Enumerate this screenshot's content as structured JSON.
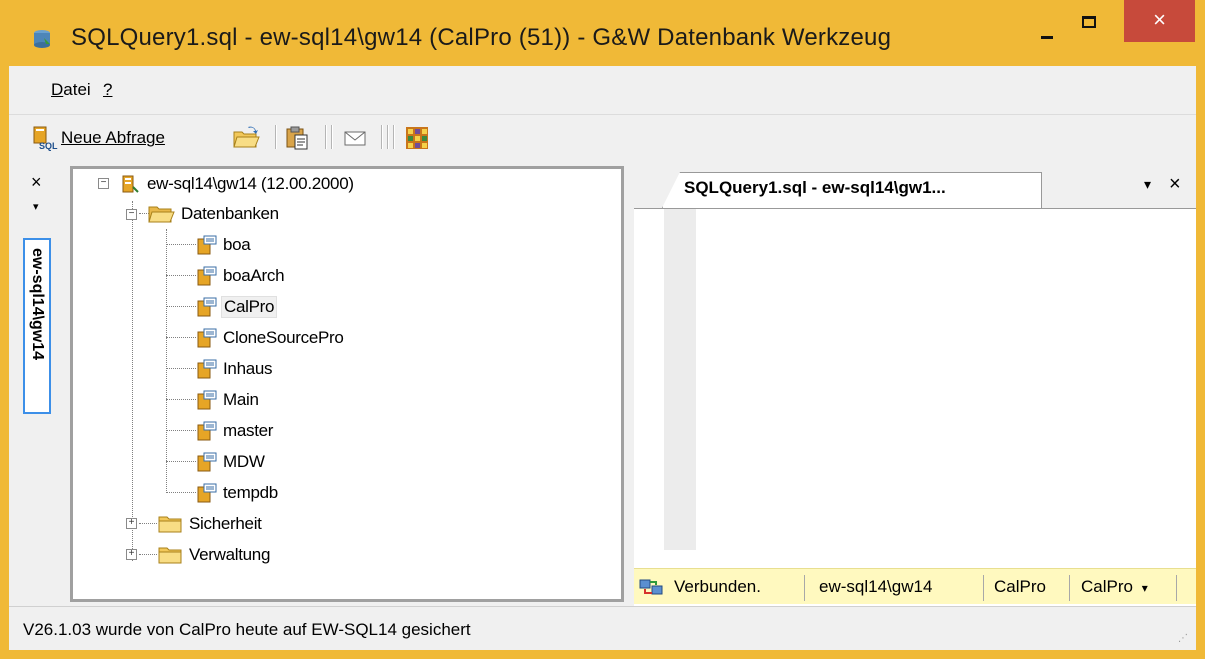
{
  "window": {
    "title": "SQLQuery1.sql - ew-sql14\\gw14 (CalPro (51)) - G&W Datenbank Werkzeug",
    "accent_color": "#f0b937",
    "close_color": "#c74a3b",
    "controls": {
      "minimize": "minimize-icon",
      "maximize": "maximize-icon",
      "close": "×"
    }
  },
  "menu": {
    "items": [
      {
        "label": "Datei",
        "accel": "D"
      },
      {
        "label": "?",
        "accel": "?"
      }
    ]
  },
  "toolbar": {
    "new_query_label": "Neue Abfrage",
    "new_query_accel": "N",
    "icons": [
      "new-query-icon",
      "open-folder-icon",
      "paste-icon",
      "mail-icon",
      "grid-icon"
    ]
  },
  "side_panel": {
    "close": "×",
    "pin": "▾",
    "tab_label": "ew-sql14\\gw14"
  },
  "tree": {
    "server": {
      "label": "ew-sql14\\gw14 (12.00.2000)",
      "expanded": true
    },
    "folders": [
      {
        "label": "Datenbanken",
        "expanded": true
      },
      {
        "label": "Sicherheit",
        "expanded": false
      },
      {
        "label": "Verwaltung",
        "expanded": false
      }
    ],
    "databases": [
      "boa",
      "boaArch",
      "CalPro",
      "CloneSourcePro",
      "Inhaus",
      "Main",
      "master",
      "MDW",
      "tempdb"
    ],
    "selected": "CalPro"
  },
  "editor": {
    "tab_label": "SQLQuery1.sql - ew-sql14\\gw1...",
    "tab_menu": "▾",
    "tab_close": "×",
    "status": {
      "connected": "Verbunden.",
      "server": "ew-sql14\\gw14",
      "login": "CalPro",
      "database": "CalPro",
      "dropdown": "▾",
      "bg_color": "#fff9bf"
    }
  },
  "statusbar": {
    "text": "V26.1.03 wurde von CalPro heute auf EW-SQL14 gesichert"
  }
}
